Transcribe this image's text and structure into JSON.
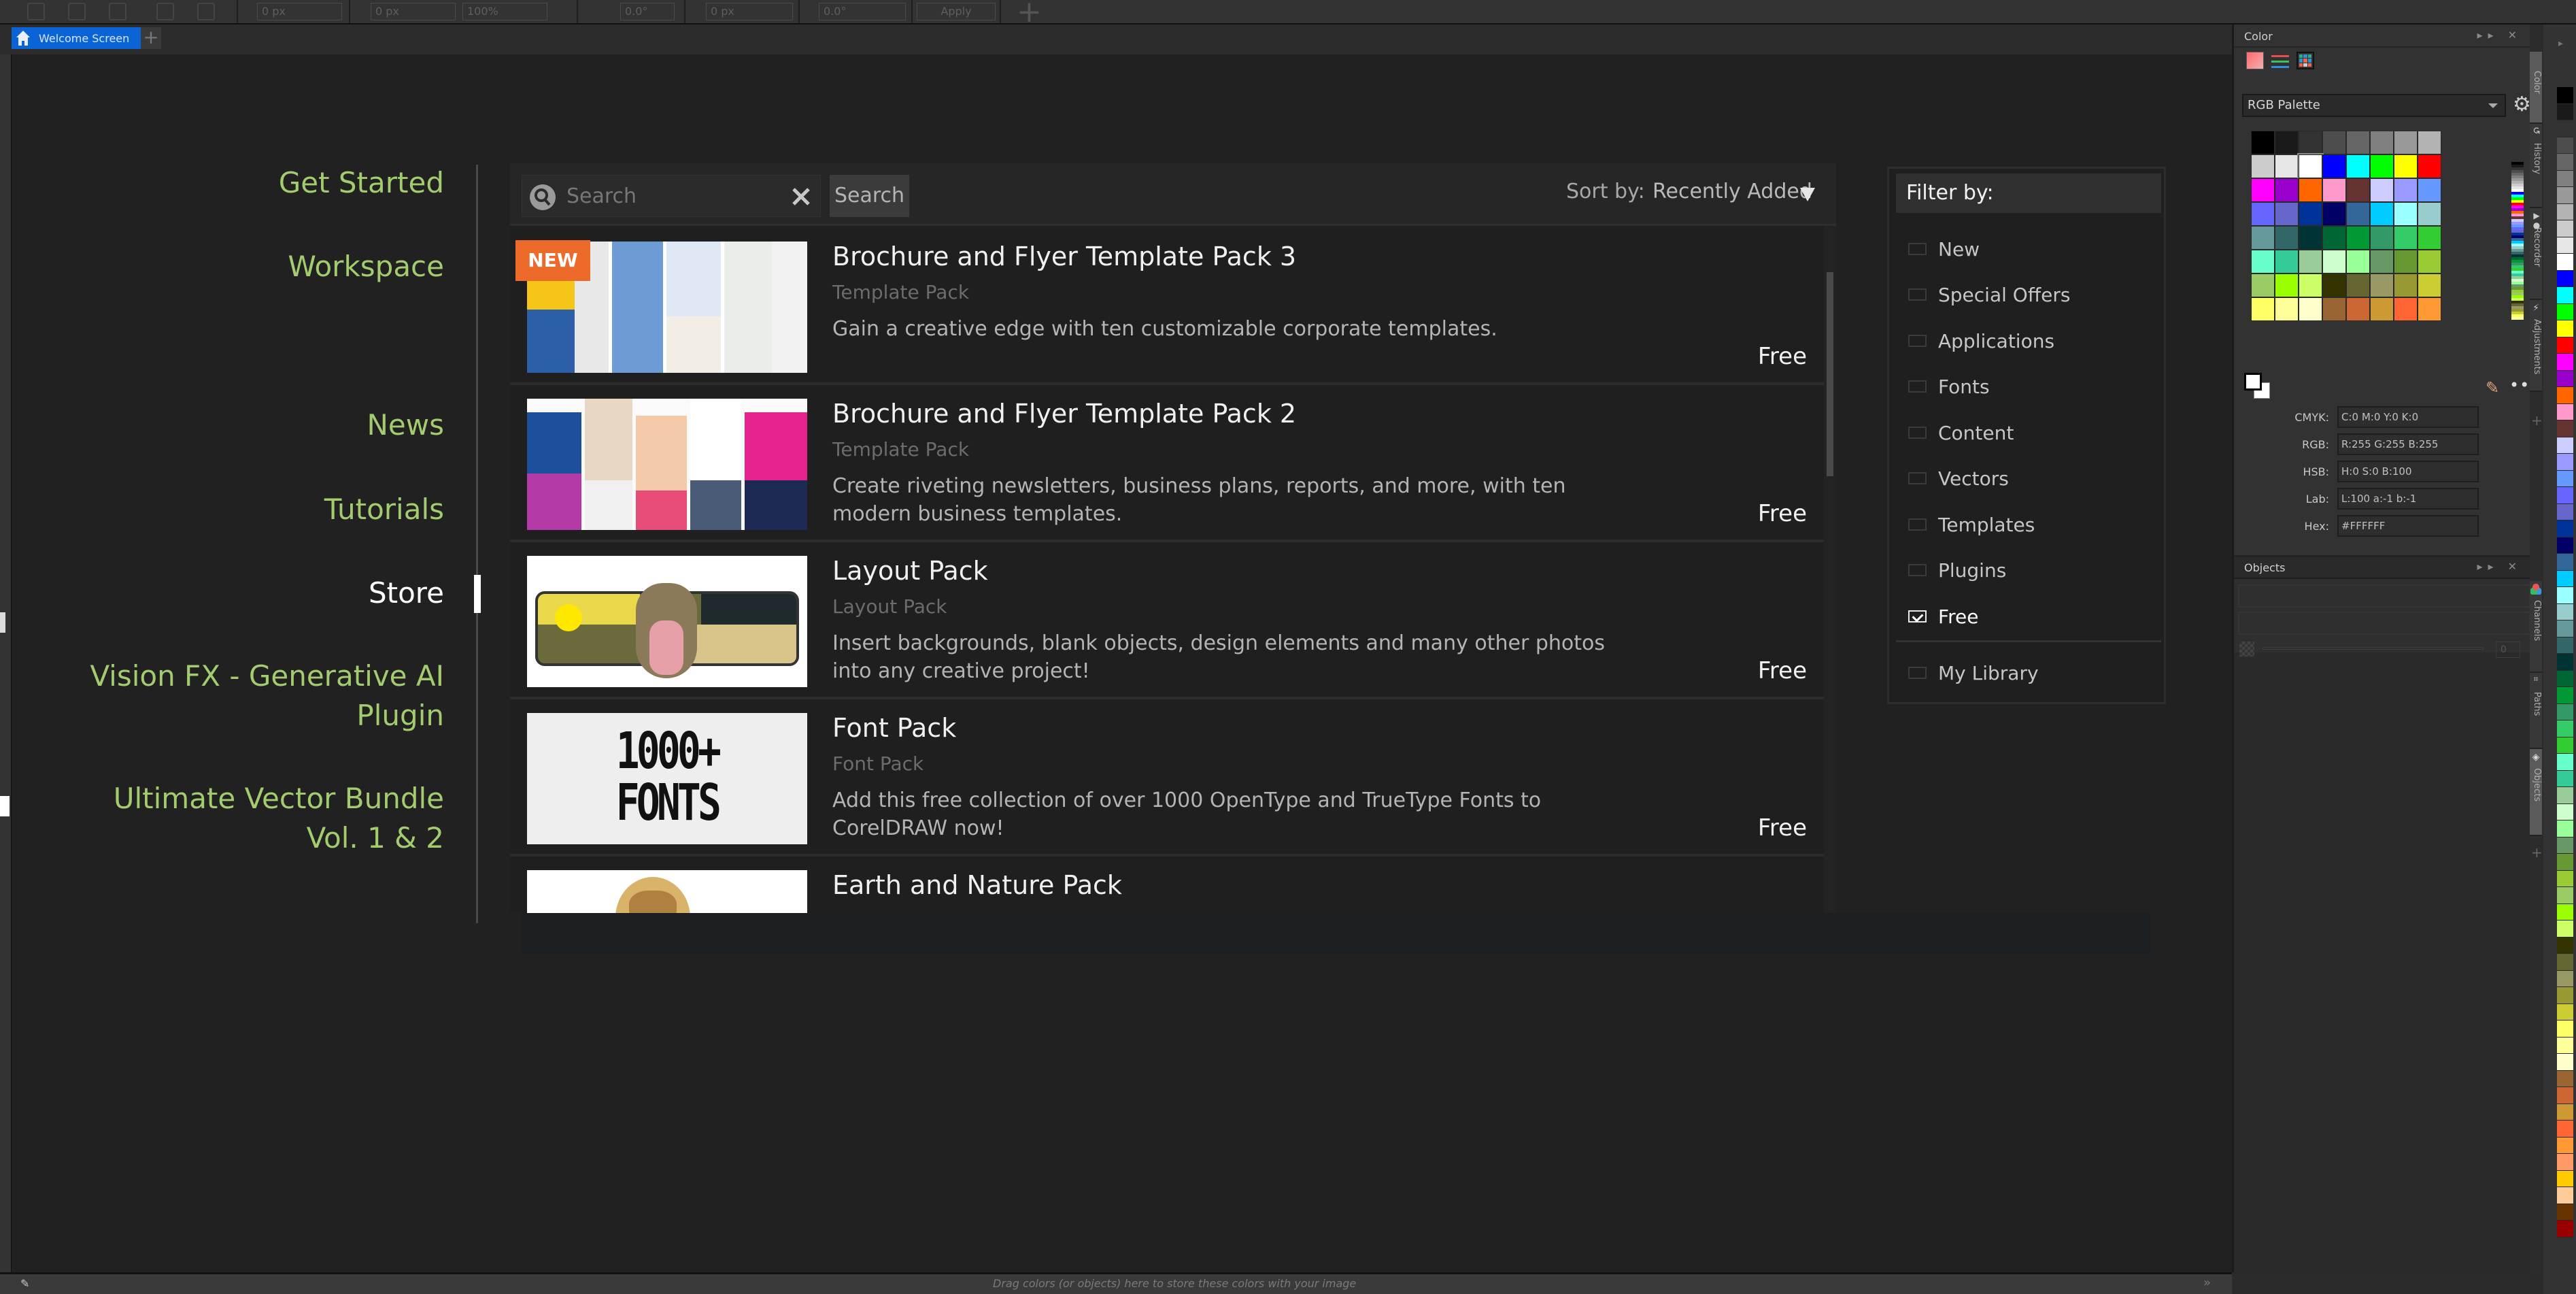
{
  "toolbar": {
    "fields": [
      "0 px",
      "0 px",
      "100%",
      "0.0°",
      "0 px",
      "0.0°"
    ],
    "apply_label": "Apply"
  },
  "tabs": [
    {
      "label": "Welcome Screen",
      "active": true
    }
  ],
  "nav": {
    "items": [
      {
        "label": "Get Started"
      },
      {
        "label": "Workspace"
      },
      {
        "label": "News"
      },
      {
        "label": "Tutorials"
      },
      {
        "label": "Store",
        "active": true
      },
      {
        "label": "Vision FX - Generative AI Plugin"
      },
      {
        "label": "Ultimate Vector Bundle Vol. 1 & 2"
      }
    ],
    "accent_color": "#a2cc6e"
  },
  "store": {
    "search_placeholder": "Search",
    "search_value": "",
    "search_button": "Search",
    "sort_label": "Sort by:",
    "sort_value": "Recently Added",
    "items": [
      {
        "title": "Brochure and Flyer Template Pack 3",
        "type": "Template Pack",
        "description": "Gain a creative edge with ten customizable corporate templates.",
        "price": "Free",
        "badge": "NEW",
        "thumb": "brochure-collage"
      },
      {
        "title": "Brochure and Flyer Template Pack 2",
        "type": "Template Pack",
        "description": "Create riveting newsletters, business plans, reports, and more, with ten modern business templates.",
        "price": "Free",
        "thumb": "brochure-collage"
      },
      {
        "title": "Layout Pack",
        "type": "Layout Pack",
        "description": "Insert backgrounds, blank objects, design elements and many other photos into any creative project!",
        "price": "Free",
        "thumb": "snake-desert"
      },
      {
        "title": "Font Pack",
        "type": "Font Pack",
        "description": "Add this free collection of over 1000 OpenType and TrueType Fonts to CorelDRAW now!",
        "price": "Free",
        "thumb": "fonts-text",
        "thumb_text": [
          "1000+",
          "FONTS"
        ]
      },
      {
        "title": "Earth and Nature Pack",
        "type": "",
        "description": "",
        "price": "",
        "thumb": "tiger"
      }
    ],
    "badge_color": "#ed6a2a"
  },
  "filter": {
    "title": "Filter by:",
    "options": [
      {
        "label": "New",
        "checked": false
      },
      {
        "label": "Special Offers",
        "checked": false
      },
      {
        "label": "Applications",
        "checked": false
      },
      {
        "label": "Fonts",
        "checked": false
      },
      {
        "label": "Content",
        "checked": false
      },
      {
        "label": "Vectors",
        "checked": false
      },
      {
        "label": "Templates",
        "checked": false
      },
      {
        "label": "Plugins",
        "checked": false
      },
      {
        "label": "Free",
        "checked": true
      }
    ],
    "library": {
      "label": "My Library",
      "checked": false
    }
  },
  "color_panel": {
    "title": "Color",
    "palette_name": "RGB Palette",
    "values": [
      {
        "key": "CMYK:",
        "value": "C:0 M:0 Y:0 K:0"
      },
      {
        "key": "RGB:",
        "value": "R:255 G:255 B:255"
      },
      {
        "key": "HSB:",
        "value": "H:0 S:0 B:100"
      },
      {
        "key": "Lab:",
        "value": "L:100 a:-1 b:-1"
      },
      {
        "key": "Hex:",
        "value": "#FFFFFF"
      }
    ],
    "swatches": [
      "#000000",
      "#1a1a1a",
      "#333333",
      "#4d4d4d",
      "#666666",
      "#808080",
      "#999999",
      "#b3b3b3",
      "#cccccc",
      "#e6e6e6",
      "#ffffff",
      "#0000ff",
      "#00ffff",
      "#00ff00",
      "#ffff00",
      "#ff0000",
      "#ff00ff",
      "#9900cc",
      "#ff6600",
      "#ff99cc",
      "#663333",
      "#ccccff",
      "#9999ff",
      "#6699ff",
      "#6666ff",
      "#6666cc",
      "#003399",
      "#000066",
      "#336699",
      "#00ccff",
      "#99ffff",
      "#99cccc",
      "#669999",
      "#336666",
      "#003333",
      "#006633",
      "#009933",
      "#339966",
      "#33cc66",
      "#33cc33",
      "#66ffcc",
      "#33cc99",
      "#99cc99",
      "#ccffcc",
      "#99ff99",
      "#669966",
      "#669933",
      "#99cc33",
      "#99cc66",
      "#99ff00",
      "#ccff66",
      "#333300",
      "#666633",
      "#999966",
      "#999933",
      "#cccc33",
      "#ffff66",
      "#ffff99",
      "#ffffcc",
      "#996633",
      "#cc6633",
      "#cc9933",
      "#ff6633",
      "#ff9933"
    ],
    "selected_swatch": "#ffffff"
  },
  "objects_panel": {
    "title": "Objects",
    "opacity_value": "0"
  },
  "vertical_tabs": [
    "Color",
    "History",
    "Recorder",
    "Adjustments",
    "Channels",
    "Paths",
    "Objects"
  ],
  "palette_strip": [
    "#000000",
    "#1a1a1a",
    "#333333",
    "#4d4d4d",
    "#666666",
    "#808080",
    "#999999",
    "#b3b3b3",
    "#cccccc",
    "#e6e6e6",
    "#ffffff",
    "#0000ff",
    "#00ffff",
    "#00ff00",
    "#ffff00",
    "#ff0000",
    "#ff00ff",
    "#9900cc",
    "#ff6600",
    "#ff99cc",
    "#663333",
    "#ccccff",
    "#9999ff",
    "#6699ff",
    "#6666ff",
    "#6666cc",
    "#003399",
    "#000066",
    "#336699",
    "#00ccff",
    "#99ffff",
    "#99cccc",
    "#669999",
    "#336666",
    "#003333",
    "#006633",
    "#009933",
    "#339966",
    "#33cc66",
    "#33cc33",
    "#66ffcc",
    "#33cc99",
    "#99cc99",
    "#ccffcc",
    "#99ff99",
    "#669966",
    "#669933",
    "#99cc33",
    "#99cc66",
    "#99ff00",
    "#ccff66",
    "#333300",
    "#666633",
    "#999966",
    "#999933",
    "#cccc33",
    "#ffff66",
    "#ffff99",
    "#ffffcc",
    "#996633",
    "#cc6633",
    "#cc9933",
    "#ff6633",
    "#ff9933",
    "#ff9966",
    "#ffcc00",
    "#ffcc99",
    "#663300",
    "#990000"
  ],
  "status": {
    "hint": "Drag colors (or objects) here to store these colors with your image"
  }
}
